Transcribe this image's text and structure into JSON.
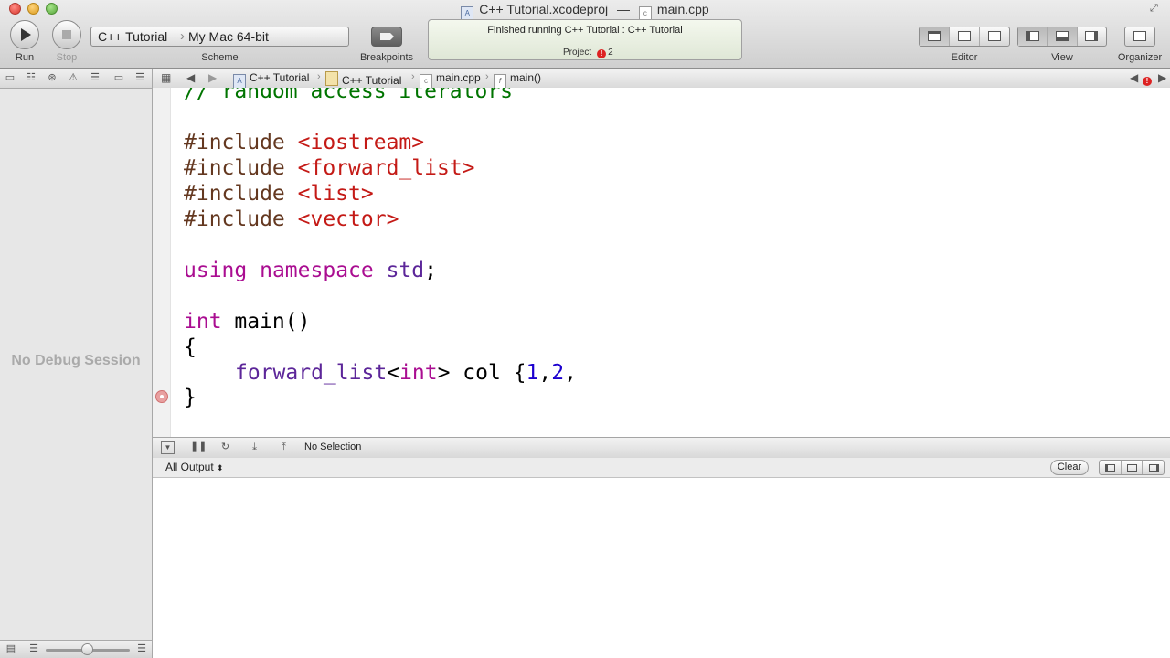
{
  "window": {
    "project_file": "C++ Tutorial.xcodeproj",
    "separator": "—",
    "current_file": "main.cpp"
  },
  "toolbar": {
    "run_label": "Run",
    "stop_label": "Stop",
    "scheme_label": "Scheme",
    "scheme_target": "C++ Tutorial",
    "scheme_destination": "My Mac 64-bit",
    "breakpoints_label": "Breakpoints",
    "activity_message": "Finished running C++ Tutorial : C++ Tutorial",
    "activity_project": "Project",
    "error_count": "2",
    "editor_label": "Editor",
    "view_label": "View",
    "organizer_label": "Organizer"
  },
  "jumpbar": {
    "items": [
      "C++ Tutorial",
      "C++ Tutorial",
      "main.cpp",
      "main()"
    ]
  },
  "sidebar": {
    "empty_message": "No Debug Session"
  },
  "editor": {
    "lines": {
      "comment": "// random access iterators",
      "inc1_dir": "#include",
      "inc1_hdr": "<iostream>",
      "inc2_dir": "#include",
      "inc2_hdr": "<forward_list>",
      "inc3_dir": "#include",
      "inc3_hdr": "<list>",
      "inc4_dir": "#include",
      "inc4_hdr": "<vector>",
      "using_kw1": "using",
      "using_kw2": "namespace",
      "using_std": "std",
      "using_semi": ";",
      "main_int": "int",
      "main_rest": " main()",
      "open_brace": "{",
      "decl_type": "forward_list",
      "decl_lt": "<",
      "decl_int": "int",
      "decl_rest": "> col {",
      "decl_n1": "1",
      "decl_comma1": ",",
      "decl_n2": "2",
      "decl_comma2": ",",
      "close_brace": "}"
    }
  },
  "debug_bar": {
    "selection_text": "No Selection"
  },
  "console": {
    "output_filter": "All Output",
    "clear_label": "Clear"
  },
  "colors": {
    "comment": "#007400",
    "preprocessor": "#643820",
    "string": "#c41a16",
    "keyword": "#aa0d91",
    "type": "#5c2699",
    "number": "#1c00cf",
    "error": "#d22222"
  }
}
